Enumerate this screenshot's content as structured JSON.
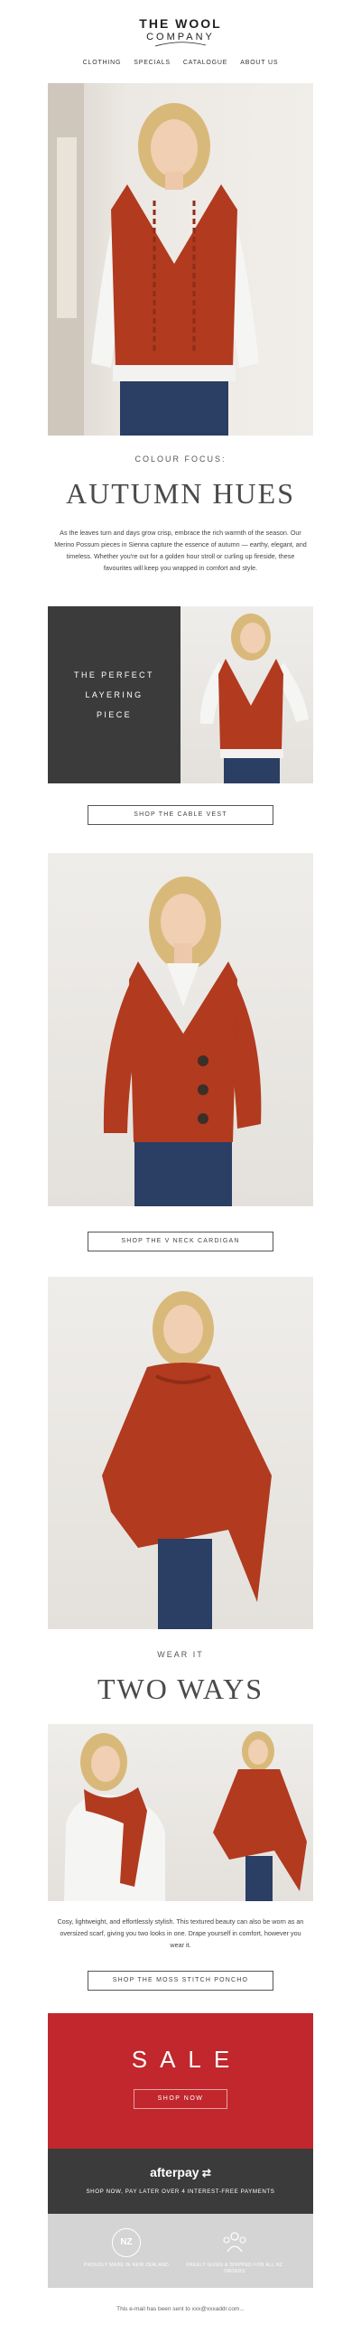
{
  "brand": {
    "line1": "THE WOOL",
    "line2": "COMPANY"
  },
  "nav": [
    "CLOTHING",
    "SPECIALS",
    "CATALOGUE",
    "ABOUT US"
  ],
  "hero": {
    "alt": "Model wearing rust cable knit vest over white shirt"
  },
  "intro": {
    "label": "COLOUR FOCUS:",
    "title": "AUTUMN HUES",
    "body": "As the leaves turn and days grow crisp, embrace the rich warmth of the season. Our Merino Possum pieces in Sienna capture the essence of autumn — earthy, elegant, and timeless. Whether you're out for a golden hour stroll or curling up fireside, these favourites will keep you wrapped in comfort and style."
  },
  "vest": {
    "panel_line1": "THE PERFECT",
    "panel_line2": "LAYERING",
    "panel_line3": "PIECE",
    "button": "SHOP THE CABLE VEST"
  },
  "cardigan": {
    "button": "SHOP THE V NECK CARDIGAN"
  },
  "poncho": {
    "label": "WEAR IT",
    "title": "TWO WAYS",
    "body": "Cosy, lightweight, and effortlessly stylish. This textured beauty can also be worn as an oversized scarf, giving you two looks in one. Drape yourself in comfort, however you wear it.",
    "button": "SHOP THE MOSS STITCH PONCHO"
  },
  "sale": {
    "title": "SALE",
    "button": "SHOP NOW"
  },
  "afterpay": {
    "logo": "afterpay",
    "text": "SHOP NOW, PAY LATER OVER 4 INTEREST-FREE PAYMENTS"
  },
  "badges": [
    {
      "icon_text": "NZ",
      "text": "PROUDLY MADE IN NEW ZEALAND"
    },
    {
      "icon_text": "",
      "text": "FREELY GIVEN & SHIPPED FOR ALL NZ ORDERS"
    }
  ],
  "footer": {
    "text": "This e-mail has been sent to xxx@xxxaddr.com..."
  },
  "colors": {
    "rust": "#b13a1f",
    "sale_red": "#c1272d",
    "dark": "#3b3b3b",
    "badge_grey": "#d4d4d4"
  }
}
